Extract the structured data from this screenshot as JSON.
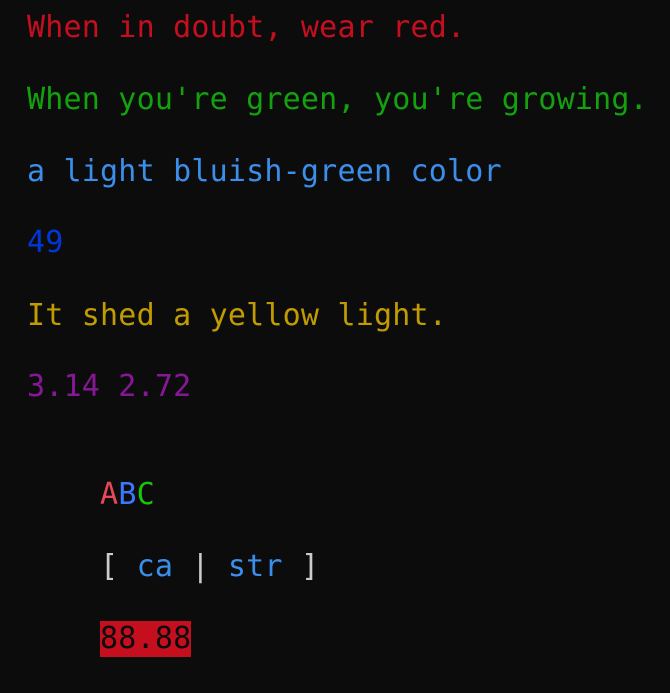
{
  "colors": {
    "background": "#0c0c0c",
    "red": "#c50f1f",
    "green": "#13a10e",
    "light_blue": "#3b8eea",
    "blue": "#0037da",
    "yellow": "#c19c00",
    "purple": "#881798",
    "a_red": "#e74856",
    "b_blue": "#3b78ff",
    "c_green": "#16c60c",
    "bracket_gray": "#cccccc",
    "ca_blue": "#3b8eea",
    "pipe_gray": "#cccccc",
    "str_blue": "#3b8eea",
    "highlight_bg": "#c50f1f",
    "highlight_fg": "#0c0c0c"
  },
  "lines": {
    "line1": "When in doubt, wear red.",
    "line2": "When you're green, you're growing.",
    "line3": "a light bluish-green color",
    "line4": "49",
    "line5": "It shed a yellow light.",
    "line6": "3.14 2.72",
    "line7": {
      "a": "A",
      "b": "B",
      "c": "C"
    },
    "line8": {
      "open": "[ ",
      "ca": "ca",
      "pipe": " | ",
      "str": "str",
      "close": " ]"
    },
    "line9": "88.88"
  }
}
